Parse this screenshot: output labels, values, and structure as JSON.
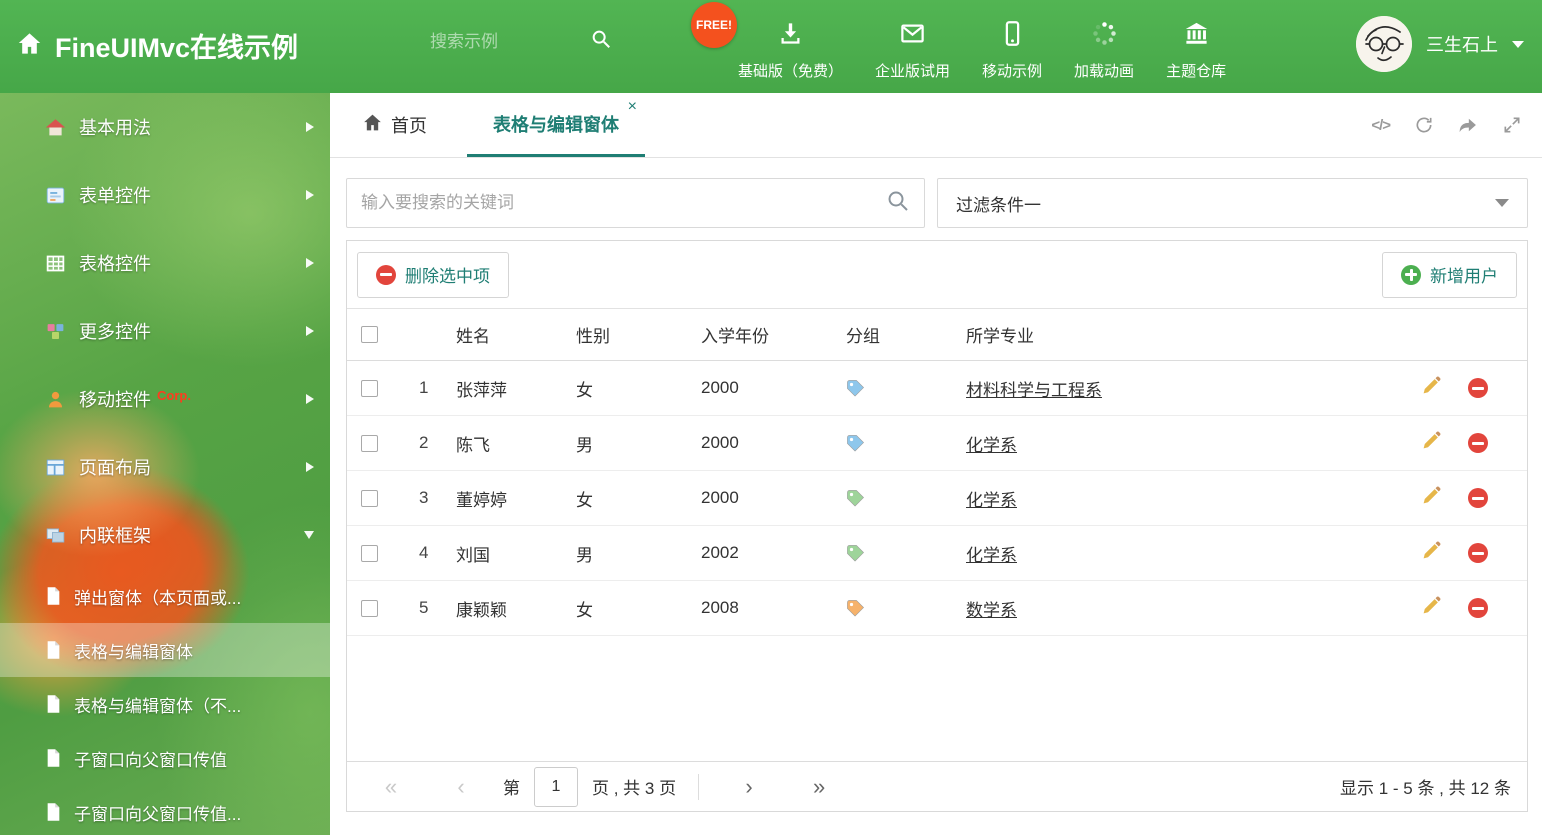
{
  "header": {
    "title": "FineUIMvc在线示例",
    "search_placeholder": "搜索示例",
    "free_badge": "FREE!",
    "nav": [
      {
        "label": "基础版（免费）",
        "icon": "download-icon"
      },
      {
        "label": "企业版试用",
        "icon": "envelope-icon"
      },
      {
        "label": "移动示例",
        "icon": "mobile-icon"
      },
      {
        "label": "加载动画",
        "icon": "spinner-icon"
      },
      {
        "label": "主题仓库",
        "icon": "bank-icon"
      }
    ],
    "username": "三生石上"
  },
  "sidebar": {
    "items": [
      {
        "label": "基本用法"
      },
      {
        "label": "表单控件"
      },
      {
        "label": "表格控件"
      },
      {
        "label": "更多控件"
      },
      {
        "label": "移动控件",
        "badge": "Corp."
      },
      {
        "label": "页面布局"
      },
      {
        "label": "内联框架"
      }
    ],
    "subitems": [
      {
        "label": "弹出窗体（本页面或..."
      },
      {
        "label": "表格与编辑窗体"
      },
      {
        "label": "表格与编辑窗体（不..."
      },
      {
        "label": "子窗口向父窗口传值"
      },
      {
        "label": "子窗口向父窗口传值..."
      }
    ]
  },
  "tabs": {
    "home": "首页",
    "active": "表格与编辑窗体",
    "close_glyph": "×",
    "code_glyph": "</>"
  },
  "filters": {
    "search_placeholder": "输入要搜索的关键词",
    "filter_selected": "过滤条件一"
  },
  "toolbar": {
    "delete_label": "删除选中项",
    "add_label": "新增用户"
  },
  "table": {
    "columns": {
      "name": "姓名",
      "gender": "性别",
      "year": "入学年份",
      "group": "分组",
      "major": "所学专业"
    },
    "rows": [
      {
        "index": "1",
        "name": "张萍萍",
        "gender": "女",
        "year": "2000",
        "tag_color": "#8ec7ec",
        "major": "材料科学与工程系"
      },
      {
        "index": "2",
        "name": "陈飞",
        "gender": "男",
        "year": "2000",
        "tag_color": "#8ec7ec",
        "major": "化学系"
      },
      {
        "index": "3",
        "name": "董婷婷",
        "gender": "女",
        "year": "2000",
        "tag_color": "#9ed49a",
        "major": "化学系"
      },
      {
        "index": "4",
        "name": "刘国",
        "gender": "男",
        "year": "2002",
        "tag_color": "#9ed49a",
        "major": "化学系"
      },
      {
        "index": "5",
        "name": "康颖颖",
        "gender": "女",
        "year": "2008",
        "tag_color": "#f6b26b",
        "major": "数学系"
      }
    ]
  },
  "pagination": {
    "first_glyph": "«",
    "prev_glyph": "‹",
    "next_glyph": "›",
    "last_glyph": "»",
    "page_prefix": "第",
    "page_value": "1",
    "page_suffix": "页 , 共 3 页",
    "summary": "显示 1 - 5 条 , 共 12 条"
  },
  "colors": {
    "header_green": "#4caf50",
    "accent_teal": "#1f7e74",
    "delete_red": "#e2453c",
    "add_green": "#4caf50",
    "edit_orange": "#e6b649"
  }
}
